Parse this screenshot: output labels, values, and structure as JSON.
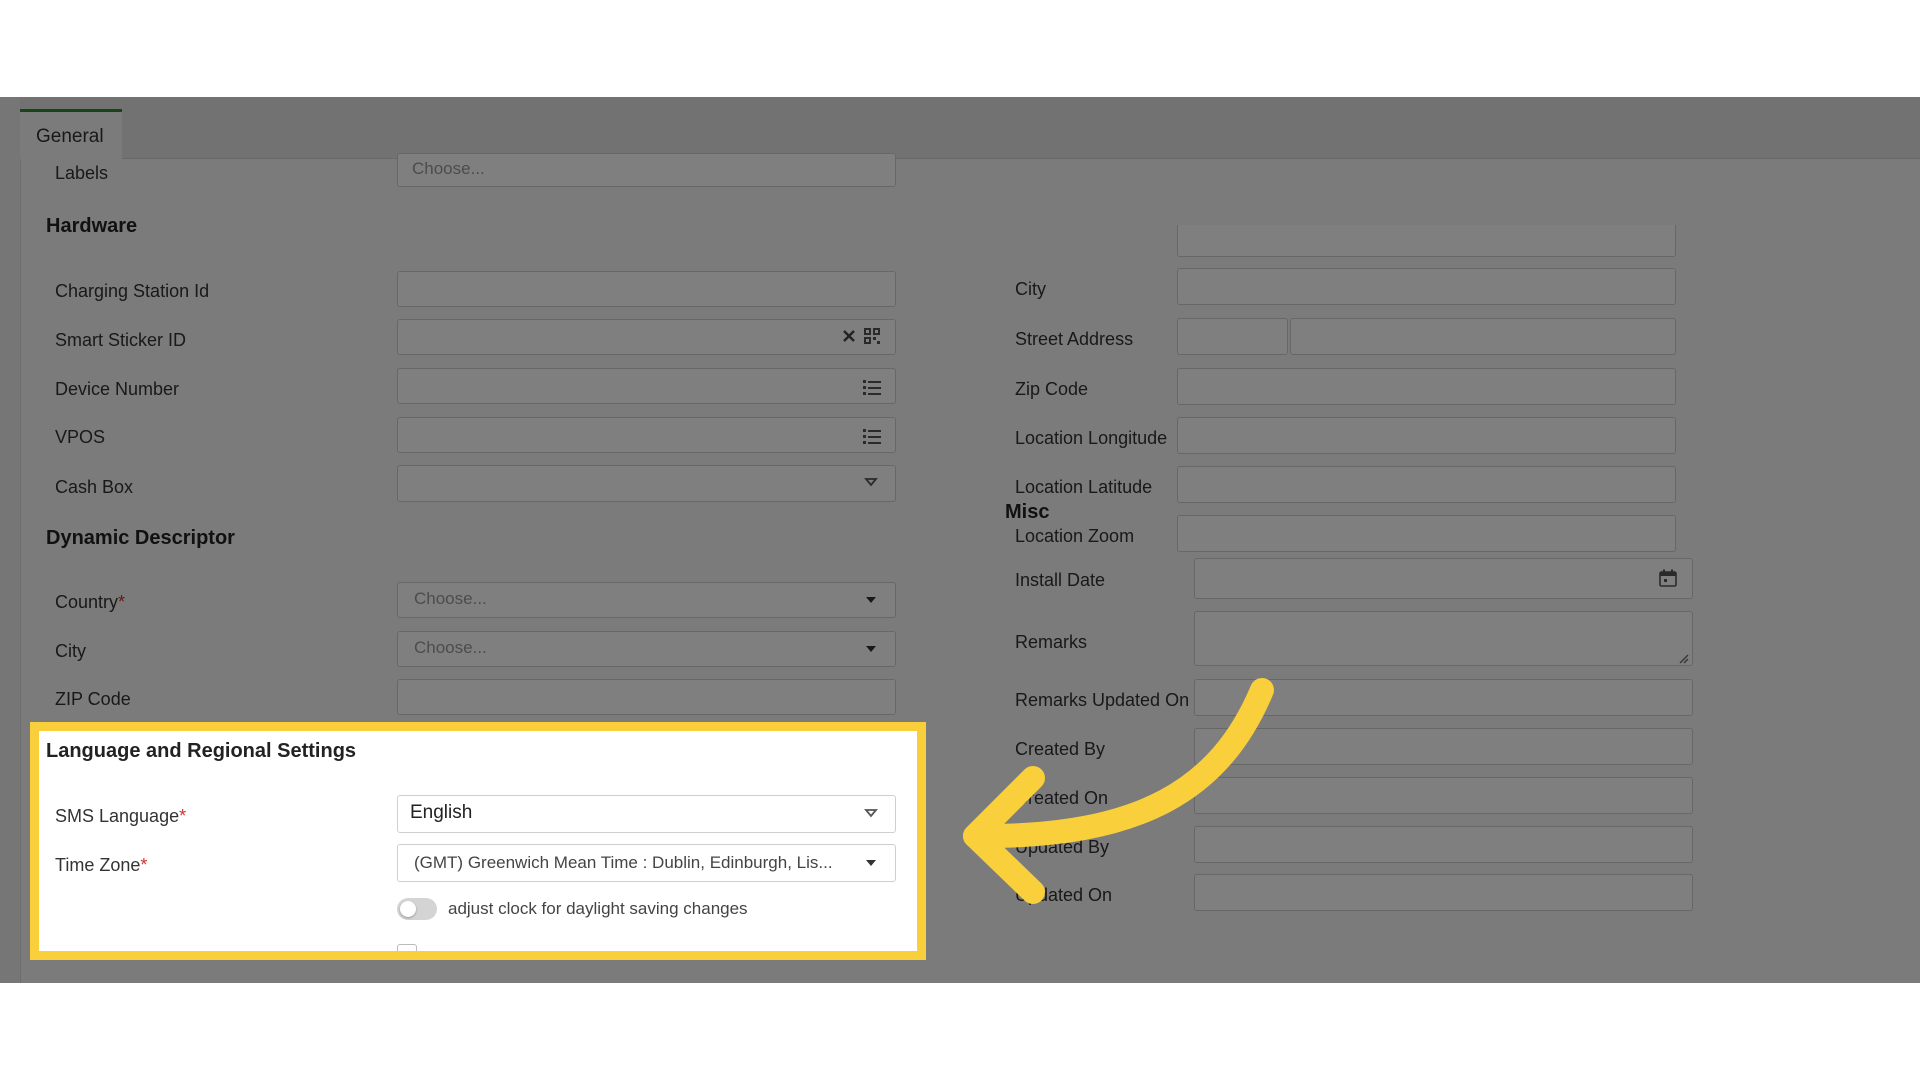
{
  "tabs": [
    {
      "label": "General"
    }
  ],
  "labels_row": {
    "label": "Labels",
    "placeholder": "Choose..."
  },
  "hardware": {
    "title": "Hardware",
    "charging_station_id": {
      "label": "Charging Station Id"
    },
    "smart_sticker_id": {
      "label": "Smart Sticker ID",
      "icons": [
        "clear-icon",
        "qr-code-icon"
      ]
    },
    "device_number": {
      "label": "Device Number",
      "icon": "list-icon"
    },
    "vpos": {
      "label": "VPOS",
      "icon": "list-icon"
    },
    "cash_box": {
      "label": "Cash Box",
      "icon": "chevron-down-icon"
    }
  },
  "dynamic_descriptor": {
    "title": "Dynamic Descriptor",
    "country": {
      "label": "Country",
      "required_mark": "*",
      "placeholder": "Choose..."
    },
    "city": {
      "label": "City",
      "placeholder": "Choose..."
    },
    "zip": {
      "label": "ZIP Code"
    }
  },
  "address": {
    "city": {
      "label": "City"
    },
    "street": {
      "label": "Street Address"
    },
    "zip": {
      "label": "Zip Code"
    },
    "longitude": {
      "label": "Location Longitude"
    },
    "latitude": {
      "label": "Location Latitude"
    },
    "zoom": {
      "label": "Location Zoom"
    }
  },
  "misc": {
    "title": "Misc",
    "install_date": {
      "label": "Install Date",
      "icon": "calendar-icon"
    },
    "remarks": {
      "label": "Remarks"
    },
    "remarks_updated_on": {
      "label": "Remarks Updated On"
    },
    "created_by": {
      "label": "Created By"
    },
    "created_on": {
      "label": "Created On"
    },
    "updated_by": {
      "label": "Updated By"
    },
    "updated_on": {
      "label": "Updated On"
    }
  },
  "language": {
    "title": "Language and Regional Settings",
    "sms_language": {
      "label": "SMS Language",
      "required_mark": "*",
      "value": "English"
    },
    "time_zone": {
      "label": "Time Zone",
      "required_mark": "*",
      "value": "(GMT) Greenwich Mean Time : Dublin, Edinburgh, Lis..."
    },
    "dst_toggle": {
      "label": "adjust clock for daylight saving changes",
      "on": false
    }
  },
  "colors": {
    "highlight_border": "#f9cf3c",
    "arrow": "#f9cf3c",
    "tab_accent": "#2f8a2f",
    "required": "#d32f2f"
  }
}
